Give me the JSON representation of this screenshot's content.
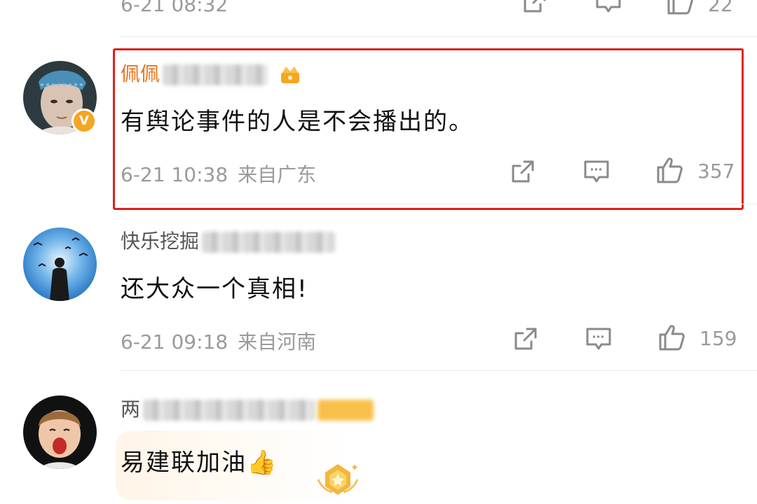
{
  "comments": [
    {
      "name": "",
      "text": "",
      "time": "6-21 08:32",
      "location": "",
      "likes": "22"
    },
    {
      "name": "佩佩",
      "name_blurred": true,
      "text": "有舆论事件的人是不会播出的。",
      "time": "6-21 10:38",
      "location": "来自广东",
      "likes": "357",
      "highlighted": true,
      "verified_badge": "V",
      "highlight_color": "#e0201c"
    },
    {
      "name": "快乐挖掘",
      "name_blurred": true,
      "text": "还大众一个真相!",
      "time": "6-21 09:18",
      "location": "来自河南",
      "likes": "159"
    },
    {
      "name": "两",
      "name_blurred": true,
      "text": "易建联加油👍",
      "time": "",
      "location": "",
      "likes": ""
    }
  ],
  "icons": {
    "share": "share-icon",
    "reply": "reply-icon",
    "like": "thumbs-up-icon",
    "crown": "crown-icon",
    "medal": "medal-icon"
  },
  "colors": {
    "vip_name": "#e8741c",
    "meta_text": "#9a9a9a",
    "highlight_border": "#e0201c"
  }
}
